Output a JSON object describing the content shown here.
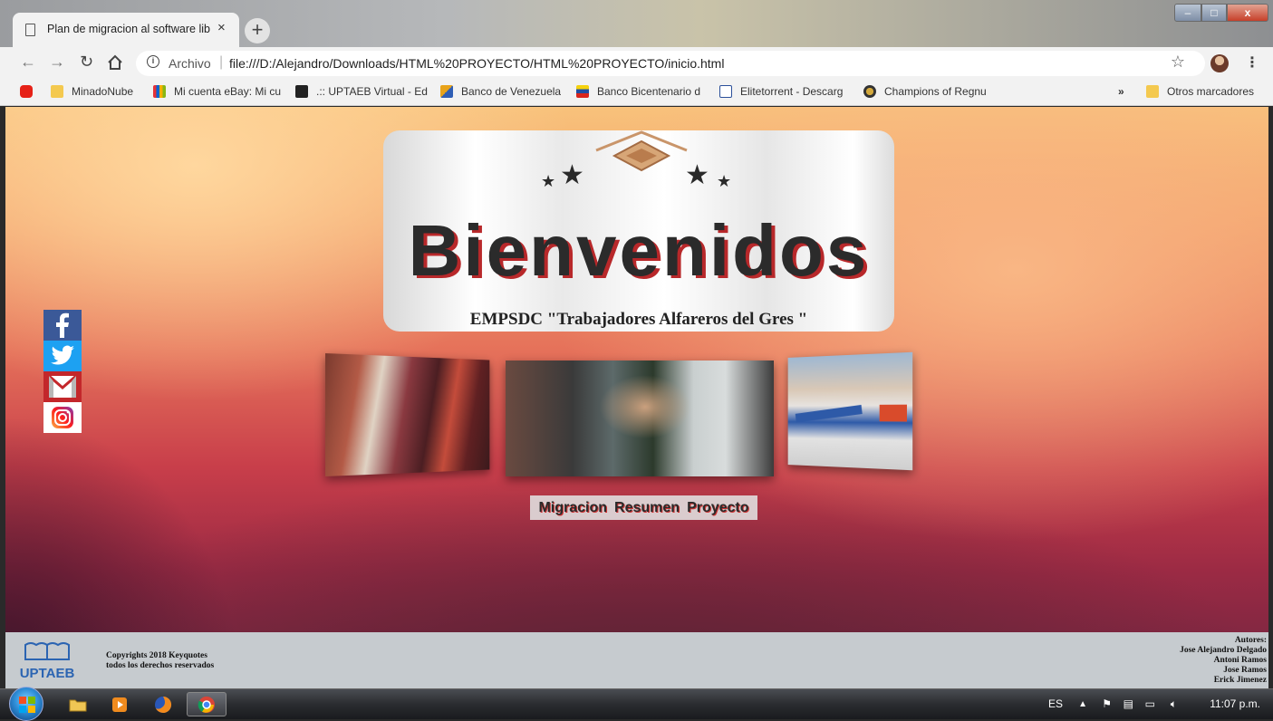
{
  "browser": {
    "tab_title": "Plan de migracion al software libr",
    "tab_close": "×",
    "new_tab": "+",
    "omnibox": {
      "scheme_label": "Archivo",
      "url": "file:///D:/Alejandro/Downloads/HTML%20PROYECTO/HTML%20PROYECTO/inicio.html"
    },
    "window_controls": {
      "minimize": "–",
      "maximize": "□",
      "close": "x"
    }
  },
  "bookmarks": [
    {
      "label": "",
      "icon": "youtube-icon",
      "color": "#e62117"
    },
    {
      "label": "MinadoNube",
      "icon": "folder-icon",
      "color": "#f4c94f"
    },
    {
      "label": "Mi cuenta eBay: Mi cu",
      "icon": "ebay-icon",
      "color": "#333333"
    },
    {
      "label": ".:: UPTAEB Virtual - Ed",
      "icon": "moodle-icon",
      "color": "#222222"
    },
    {
      "label": "Banco de Venezuela",
      "icon": "bank-icon",
      "color": "#e8a31a"
    },
    {
      "label": "Banco Bicentenario d",
      "icon": "flag-icon",
      "color": "#d9251d"
    },
    {
      "label": "Elitetorrent - Descarg",
      "icon": "torrent-icon",
      "color": "#2b4f9a"
    },
    {
      "label": "Champions of Regnu",
      "icon": "game-icon",
      "color": "#444444"
    }
  ],
  "bookmarks_overflow": "»",
  "bookmarks_other": "Otros marcadores",
  "page": {
    "welcome": "Bienvenidos",
    "organization": "EMPSDC \"Trabajadores Alfareros del Gres \"",
    "social": [
      "facebook",
      "twitter",
      "gmail",
      "instagram"
    ],
    "nav_links": [
      "Migracion",
      "Resumen",
      "Proyecto"
    ],
    "gallery": [
      "students-working-photo",
      "computer-repair-photo",
      "alfareros-building-photo"
    ],
    "footer": {
      "logo_text": "UPTAEB",
      "copyright_line1": "Copyrights 2018 Keyquotes",
      "copyright_line2": "todos los derechos reservados",
      "authors_title": "Autores:",
      "authors": [
        "Jose Alejandro Delgado",
        "Antoni Ramos",
        "Jose Ramos",
        "Erick Jimenez"
      ]
    },
    "colors": {
      "title_shadow": "#b8282a",
      "accent": "#c83e4a"
    }
  },
  "taskbar": {
    "language": "ES",
    "time": "11:07 p.m.",
    "apps": [
      "explorer-icon",
      "media-player-icon",
      "firefox-icon",
      "chrome-icon"
    ]
  }
}
